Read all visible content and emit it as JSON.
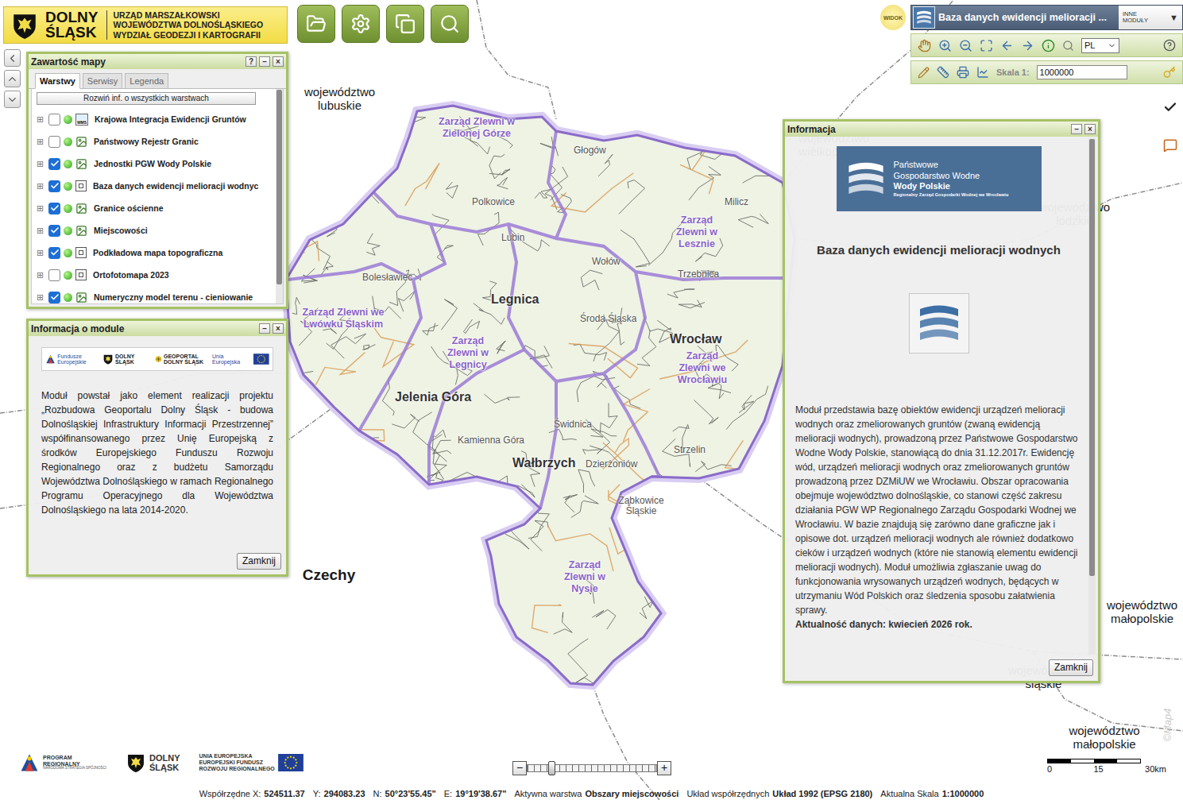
{
  "header": {
    "logo": [
      "DOLNY",
      "ŚLĄSK"
    ],
    "office": [
      "URZĄD MARSZAŁKOWSKI",
      "WOJEWÓDZTWA DOLNOŚLĄSKIEGO",
      "WYDZIAŁ GEODEZJI I KARTOGRAFII"
    ]
  },
  "view_badge": "WIDOK",
  "module_select": {
    "label": "Baza danych ewidencji melioracji ...",
    "other": [
      "INNE",
      "MODUŁY"
    ],
    "arrow": "▼"
  },
  "tools": {
    "language": "PL",
    "scale_label": "Skala 1:",
    "scale_value": "1000000"
  },
  "layers_panel": {
    "title": "Zawartość mapy",
    "controls": [
      "?",
      "–",
      "×"
    ],
    "tabs": [
      {
        "label": "Warstwy",
        "selected": true
      },
      {
        "label": "Serwisy",
        "selected": false
      },
      {
        "label": "Legenda",
        "selected": false
      }
    ],
    "expand_all": "Rozwiń inf. o wszystkich warstwach",
    "expander": "⊞",
    "layers": [
      {
        "name": "Krajowa Integracja Ewidencji Gruntów",
        "checked": false,
        "kind": "wms",
        "badge": "WMS"
      },
      {
        "name": "Państwowy Rejestr Granic",
        "checked": false,
        "kind": "image"
      },
      {
        "name": "Jednostki PGW Wody Polskie",
        "checked": true,
        "kind": "image"
      },
      {
        "name": "Baza danych ewidencji melioracji wodnyc",
        "checked": true,
        "kind": "tile"
      },
      {
        "name": "Granice ościenne",
        "checked": true,
        "kind": "image"
      },
      {
        "name": "Miejscowości",
        "checked": true,
        "kind": "image"
      },
      {
        "name": "Podkładowa mapa topograficzna",
        "checked": true,
        "kind": "tile"
      },
      {
        "name": "Ortofotomapa 2023",
        "checked": false,
        "kind": "tile"
      },
      {
        "name": "Numeryczny model terenu - cieniowanie",
        "checked": true,
        "kind": "image"
      }
    ]
  },
  "module_panel": {
    "title": "Informacja o module",
    "controls": [
      "–",
      "×"
    ],
    "logos": [
      {
        "kind": "fe",
        "text": "Fundusze Europejskie"
      },
      {
        "kind": "ds",
        "text": "DOLNY ŚLĄSK"
      },
      {
        "kind": "geo",
        "text": "GEOPORTAL DOLNY ŚLĄSK"
      },
      {
        "kind": "eu",
        "text": "Unia Europejska"
      }
    ],
    "text": "Moduł powstał jako element realizacji projektu „Rozbudowa Geoportalu Dolny Śląsk - budowa Dolnośląskiej Infrastruktury Informacji Przestrzennej” współfinansowanego przez Unię Europejską z środków Europejskiego Funduszu Rozwoju Regionalnego oraz z budżetu Samorządu Województwa Dolnośląskiego w ramach Regionalnego Programu Operacyjnego dla Województwa Dolnośląskiego na lata 2014-2020.",
    "button": "Zamknij"
  },
  "info_panel": {
    "title": "Informacja",
    "controls": [
      "–",
      "×"
    ],
    "logo": [
      "Państwowe",
      "Gospodarstwo Wodne",
      "Wody Polskie",
      "Regionalny Zarząd Gospodarki Wodnej we Wrocławiu"
    ],
    "heading": "Baza danych ewidencji melioracji wodnych",
    "text": "Moduł przedstawia bazę obiektów ewidencji urządzeń melioracji wodnych oraz zmeliorowanych gruntów (zwaną ewidencją melioracji wodnych), prowadzoną przez Państwowe Gospodarstwo Wodne Wody Polskie, stanowiącą do dnia 31.12.2017r. Ewidencję wód, urządzeń melioracji wodnych oraz zmeliorowanych gruntów prowadzoną przez DZMiUW we Wrocławiu. Obszar opracowania obejmuje województwo dolnośląskie, co stanowi część zakresu działania PGW WP Regionalnego Zarządu Gospodarki Wodnej we Wrocławiu. W bazie znajdują się zarówno dane graficzne jak i opisowe dot. urządzeń melioracji wodnych ale również dodatkowo cieków i urządzeń wodnych (które nie stanowią elementu ewidencji melioracji wodnych). Moduł umożliwia zgłaszanie uwag do funkcjonowania wrysowanych urządzeń wodnych, będących w utrzymaniu Wód Polskich oraz śledzenia sposobu załatwienia sprawy.",
    "currency": "Aktualność danych: kwiecień 2026 rok.",
    "button": "Zamknij"
  },
  "map": {
    "neighbors": [
      "województwo lubuskie",
      "województwo wielkopolskie",
      "województwo łódzkie",
      "województwo małopolskie",
      "województwo śląskie",
      "województwo małopolskie",
      "Czechy"
    ],
    "catchments": [
      "Zarząd Zlewni w Zielonej Górze",
      "Zarząd Zlewni w Lesznie",
      "Zarząd Zlewni we Lwówku Śląskim",
      "Zarząd Zlewni w Legnicy",
      "Zarząd Zlewni we Wrocławiu",
      "Zarząd Zlewni w Nysie"
    ],
    "places": [
      {
        "name": "Legnica",
        "kind": "major"
      },
      {
        "name": "Wrocław",
        "kind": "major"
      },
      {
        "name": "Jelenia Góra",
        "kind": "major"
      },
      {
        "name": "Wałbrzych",
        "kind": "major"
      },
      {
        "name": "Polkowice",
        "kind": "minor"
      },
      {
        "name": "Lubin",
        "kind": "minor"
      },
      {
        "name": "Bolesławiec",
        "kind": "minor"
      },
      {
        "name": "Świdnica",
        "kind": "minor"
      },
      {
        "name": "Kamienna Góra",
        "kind": "minor"
      },
      {
        "name": "Dzierżoniów",
        "kind": "minor"
      },
      {
        "name": "Ząbkowice Śląskie",
        "kind": "minor"
      },
      {
        "name": "Trzebnica",
        "kind": "minor"
      },
      {
        "name": "Środa Śląska",
        "kind": "minor"
      },
      {
        "name": "Strzelin",
        "kind": "minor"
      },
      {
        "name": "Milicz",
        "kind": "minor"
      },
      {
        "name": "Wołów",
        "kind": "minor"
      },
      {
        "name": "Głogów",
        "kind": "minor"
      }
    ],
    "watermark": "©Map4"
  },
  "zoom": {
    "minus": "−",
    "plus": "+",
    "level": 0.17
  },
  "scale_bar": [
    "0",
    "15",
    "30km"
  ],
  "footer_logos": [
    {
      "kind": "fe",
      "lines": [
        "PROGRAM",
        "REGIONALNY",
        "NARODOWA STRATEGIA SPÓJNOŚCI"
      ]
    },
    {
      "kind": "ds",
      "lines": [
        "DOLNY",
        "ŚLĄSK"
      ]
    },
    {
      "kind": "eu",
      "lines": [
        "UNIA EUROPEJSKA",
        "EUROPEJSKI FUNDUSZ",
        "ROZWOJU REGIONALNEGO"
      ]
    }
  ],
  "status_bar": [
    {
      "label": "Współrzędne X:",
      "value": "524511.37"
    },
    {
      "label": "Y:",
      "value": "294083.23"
    },
    {
      "label": "N:",
      "value": "50°23'55.45\""
    },
    {
      "label": "E:",
      "value": "19°19'38.67\""
    },
    {
      "label": "Aktywna warstwa",
      "value": "Obszary miejscowości"
    },
    {
      "label": "Układ współrzędnych",
      "value": "Układ 1992 (EPSG 2180)"
    },
    {
      "label": "Aktualna Skala",
      "value": "1:1000000"
    }
  ]
}
